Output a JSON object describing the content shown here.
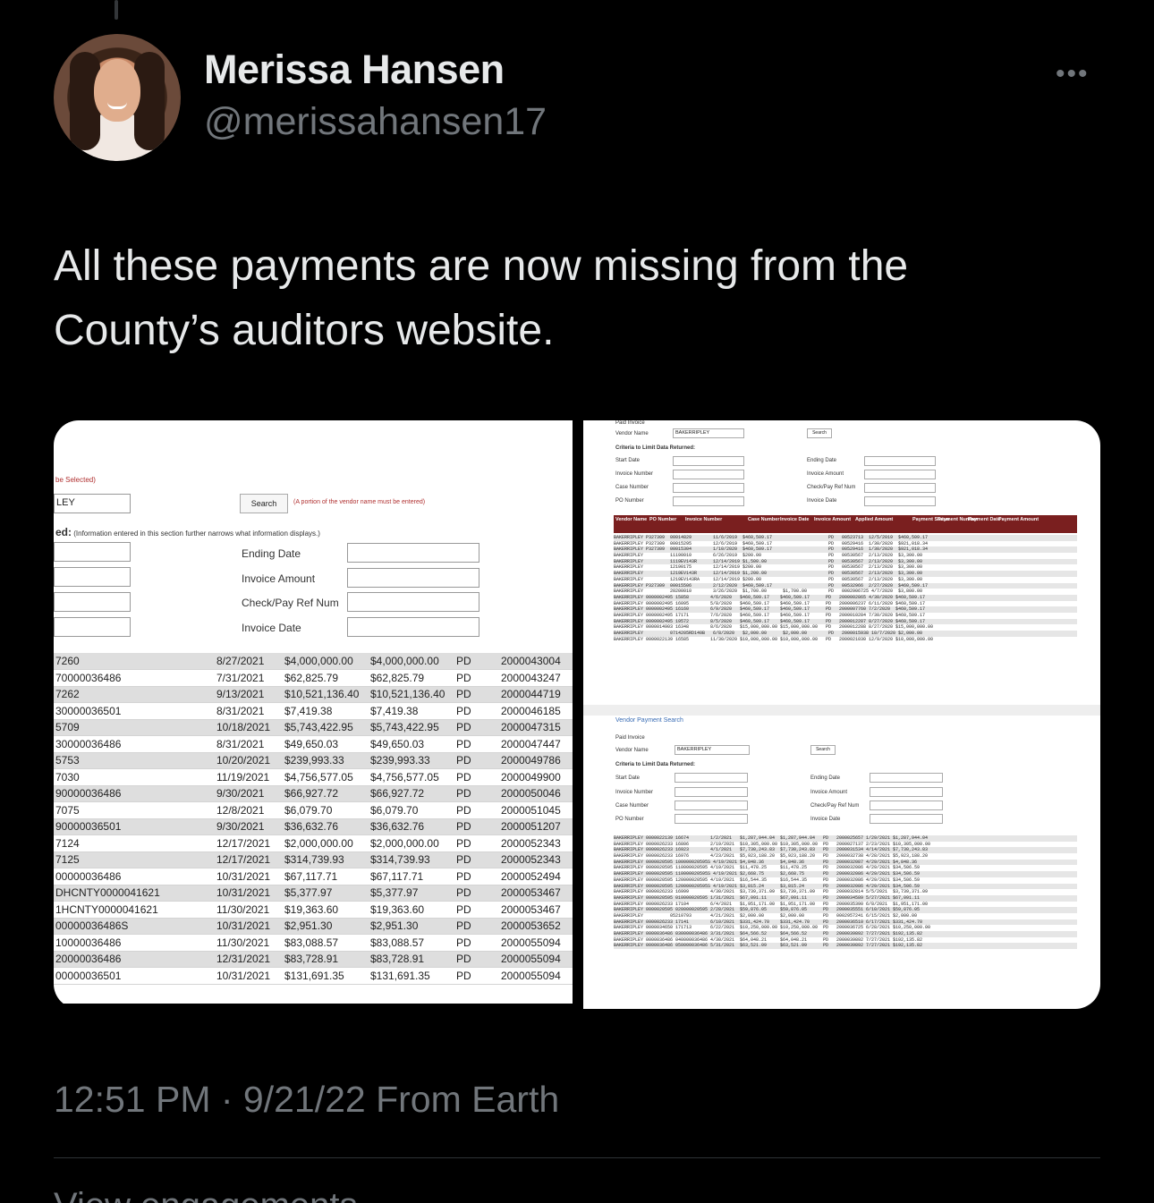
{
  "tweet": {
    "display_name": "Merissa Hansen",
    "handle": "@merissahansen17",
    "more_label": "•••",
    "text_line1": "All these payments are now missing from the",
    "text_line2": "County’s auditors website.",
    "timestamp": "12:51 PM · 9/21/22 From Earth",
    "view_engagements": "View engagements"
  },
  "left_shot": {
    "selected_note": "be Selected)",
    "vendor_value": "LEY",
    "search_label": "Search",
    "portion_note": "(A portion of the vendor name must be entered)",
    "criteria_prefix": "ed:",
    "criteria_note": "(Information entered in this section further narrows what information displays.)",
    "fields": [
      "Ending Date",
      "Invoice Amount",
      "Check/Pay Ref Num",
      "Invoice Date"
    ],
    "rows": [
      [
        "7260",
        "8/27/2021",
        "$4,000,000.00",
        "$4,000,000.00",
        "PD",
        "2000043004"
      ],
      [
        "70000036486",
        "7/31/2021",
        "$62,825.79",
        "$62,825.79",
        "PD",
        "2000043247"
      ],
      [
        "7262",
        "9/13/2021",
        "$10,521,136.40",
        "$10,521,136.40",
        "PD",
        "2000044719"
      ],
      [
        "30000036501",
        "8/31/2021",
        "$7,419.38",
        "$7,419.38",
        "PD",
        "2000046185"
      ],
      [
        "5709",
        "10/18/2021",
        "$5,743,422.95",
        "$5,743,422.95",
        "PD",
        "2000047315"
      ],
      [
        "30000036486",
        "8/31/2021",
        "$49,650.03",
        "$49,650.03",
        "PD",
        "2000047447"
      ],
      [
        "5753",
        "10/20/2021",
        "$239,993.33",
        "$239,993.33",
        "PD",
        "2000049786"
      ],
      [
        "7030",
        "11/19/2021",
        "$4,756,577.05",
        "$4,756,577.05",
        "PD",
        "2000049900"
      ],
      [
        "90000036486",
        "9/30/2021",
        "$66,927.72",
        "$66,927.72",
        "PD",
        "2000050046"
      ],
      [
        "7075",
        "12/8/2021",
        "$6,079.70",
        "$6,079.70",
        "PD",
        "2000051045"
      ],
      [
        "90000036501",
        "9/30/2021",
        "$36,632.76",
        "$36,632.76",
        "PD",
        "2000051207"
      ],
      [
        "7124",
        "12/17/2021",
        "$2,000,000.00",
        "$2,000,000.00",
        "PD",
        "2000052343"
      ],
      [
        "7125",
        "12/17/2021",
        "$314,739.93",
        "$314,739.93",
        "PD",
        "2000052343"
      ],
      [
        "00000036486",
        "10/31/2021",
        "$67,117.71",
        "$67,117.71",
        "PD",
        "2000052494"
      ],
      [
        "DHCNTY0000041621",
        "10/31/2021",
        "$5,377.97",
        "$5,377.97",
        "PD",
        "2000053467"
      ],
      [
        "1HCNTY0000041621",
        "11/30/2021",
        "$19,363.60",
        "$19,363.60",
        "PD",
        "2000053467"
      ],
      [
        "00000036486S",
        "10/31/2021",
        "$2,951.30",
        "$2,951.30",
        "PD",
        "2000053652"
      ],
      [
        "10000036486",
        "11/30/2021",
        "$83,088.57",
        "$83,088.57",
        "PD",
        "2000055094"
      ],
      [
        "20000036486",
        "12/31/2021",
        "$83,728.91",
        "$83,728.91",
        "PD",
        "2000055094"
      ],
      [
        "00000036501",
        "10/31/2021",
        "$131,691.35",
        "$131,691.35",
        "PD",
        "2000055094"
      ]
    ]
  },
  "right_shot": {
    "paid_invoice": "Paid  Invoice",
    "vendor_label": "Vendor Name",
    "vendor_value": "BAKERRIPLEY",
    "search_label": "Search",
    "criteria_label": "Criteria to Limit Data Returned:",
    "left_fields": [
      "Start Date",
      "Invoice Number",
      "Case Number",
      "PO Number"
    ],
    "right_fields": [
      "Ending Date",
      "Invoice Amount",
      "Check/Pay Ref Num",
      "Invoice Date"
    ],
    "headers": [
      "Vendor Name",
      "PO Number",
      "Invoice Number",
      "Case Number",
      "Invoice Date",
      "Invoice Amount",
      "Applied Amount",
      "Payment Status",
      "Payment Number",
      "Payment Date",
      "Payment Amount"
    ],
    "top_rows": [
      "BAKERRIPLEY P327309  00014829        11/6/2019  $460,509.17                     PD   00523713  12/5/2019  $460,509.17",
      "BAKERRIPLEY P327309  00015295        12/6/2019  $460,509.17                     PD   00529416  1/30/2020  $921,018.34",
      "BAKERRIPLEY P327309  00015304        1/10/2020  $460,509.17                     PD   00529416  1/30/2020  $921,018.34",
      "BAKERRIPLEY          11190010        6/26/2019  $200.00                         PD   00530567  2/13/2020  $3,300.00",
      "BAKERRIPLEY          1119EV143R      12/14/2019 $1,500.00                       PD   00530567  2/13/2020  $3,300.00",
      "BAKERRIPLEY          12190175        12/14/2019 $200.00                         PD   00530567  2/13/2020  $3,300.00",
      "BAKERRIPLEY          1219EV143R      12/14/2019 $1,200.00                       PD   00530567  2/13/2020  $3,300.00",
      "BAKERRIPLEY          1219EV143RA     12/14/2019 $200.00                         PD   00530567  2/13/2020  $3,300.00",
      "BAKERRIPLEY P327309  00015506        2/12/2020  $460,509.17                     PD   00532966  2/27/2020  $460,509.17",
      "BAKERRIPLEY          20200010        3/26/2020  $1,700.00      $1,700.00        PD   0002906725 4/7/2020  $3,800.00",
      "BAKERRIPLEY 0000002495 15858        4/6/2020   $460,509.17    $460,509.17      PD   2000002865 4/30/2020 $460,509.17",
      "BAKERRIPLEY 0000002495 16095        5/8/2020   $460,509.17    $460,509.17      PD   2000006237 6/11/2020 $460,509.17",
      "BAKERRIPLEY 0000002495 16160        6/9/2020   $460,509.17    $460,509.17      PD   2000007760 7/2/2020  $460,509.17",
      "BAKERRIPLEY 0000002495 17171        7/6/2020   $460,509.17    $460,509.17      PD   2000010284 7/30/2020 $460,509.17",
      "BAKERRIPLEY 0000002495 19572        8/5/2020   $460,509.17    $460,509.17      PD   2000012287 8/27/2020 $460,509.17",
      "BAKERRIPLEY 0000014903 16348        8/6/2020   $15,000,000.00 $15,000,000.00   PD   2000012288 8/27/2020 $15,000,000.00",
      "BAKERRIPLEY          0714205RD140B   6/8/2020   $2,000.00      $2,000.00        PD   2000015938 10/7/2020 $2,000.00",
      "BAKERRIPLEY 0000022139 16585        11/30/2020 $10,000,000.00 $10,000,000.00   PD   2000021030 12/9/2020 $10,000,000.00"
    ],
    "bottom_title": "Vendor Payment Search",
    "bottom_rows": [
      "BAKERRIPLEY 0000022139 16674        1/2/2021   $1,287,944.04  $1,287,944.04   PD   2000025657 1/29/2021 $1,287,944.04",
      "BAKERRIPLEY 0000026233 16806        2/19/2021  $10,305,000.00 $10,305,000.00  PD   2000027137 2/23/2021 $10,305,000.00",
      "BAKERRIPLEY 0000026233 16923        4/1/2021   $7,730,243.83  $7,730,243.83   PD   2000031534 4/14/2021 $7,730,243.83",
      "BAKERRIPLEY 0000026233 16976        4/23/2021  $5,923,188.20  $5,923,188.20   PD   2000032738 4/28/2021 $5,923,188.20",
      "BAKERRIPLEY 0000020595 100000020595S 4/19/2021 $4,848.36      $4,848.36       PD   2000032087 4/29/2021 $4,848.36",
      "BAKERRIPLEY 0000020595 110000020595 4/19/2021  $11,478.25     $11,478.25      PD   2000032086 4/29/2021 $34,506.59",
      "BAKERRIPLEY 0000020595 110000020595S 4/19/2021 $2,668.75      $2,668.75       PD   2000032086 4/29/2021 $34,506.59",
      "BAKERRIPLEY 0000020595 120000020595 4/19/2021  $16,544.35     $16,544.35      PD   2000032086 4/29/2021 $34,506.59",
      "BAKERRIPLEY 0000020595 120000020595S 4/19/2021 $3,815.24      $3,815.24       PD   2000032086 4/29/2021 $34,506.59",
      "BAKERRIPLEY 0000026233 16999        4/30/2021  $3,739,371.09  $3,739,371.09   PD   2000032814 5/5/2021  $3,739,371.09",
      "BAKERRIPLEY 0000020595 010000020595 1/31/2021  $67,091.11     $67,091.11      PD   2000034589 5/27/2021 $67,091.11",
      "BAKERRIPLEY 0000026233 17104        6/4/2021   $1,951,171.00  $1,951,171.00   PD   2000035390 6/8/2021  $1,951,171.00",
      "BAKERRIPLEY 0000020595 020000020595 2/28/2021  $59,876.05     $59,876.05      PD   2000035551 6/10/2021 $59,876.05",
      "BAKERRIPLEY          05210793       4/21/2021  $2,000.00      $2,000.00       PD   0002957241 6/15/2021 $2,000.00",
      "BAKERRIPLEY 0000026233 17141        6/10/2021  $331,424.70    $331,424.70     PD   2000036510 6/17/2021 $331,424.70",
      "BAKERRIPLEY 0000034650 171713       6/22/2021  $10,250,000.00 $10,250,000.00  PD   2000036725 6/28/2021 $10,250,000.00",
      "BAKERRIPLEY 0000036486 030000036486 3/31/2021  $64,566.52     $64,566.52      PD   2000039892 7/27/2021 $192,135.82",
      "BAKERRIPLEY 0000036486 040000036486 4/30/2021  $64,048.21     $64,048.21      PD   2000039892 7/27/2021 $192,135.82",
      "BAKERRIPLEY 0000036486 050000036486 5/31/2021  $63,521.09     $63,521.09      PD   2000039892 7/27/2021 $192,135.82"
    ]
  }
}
